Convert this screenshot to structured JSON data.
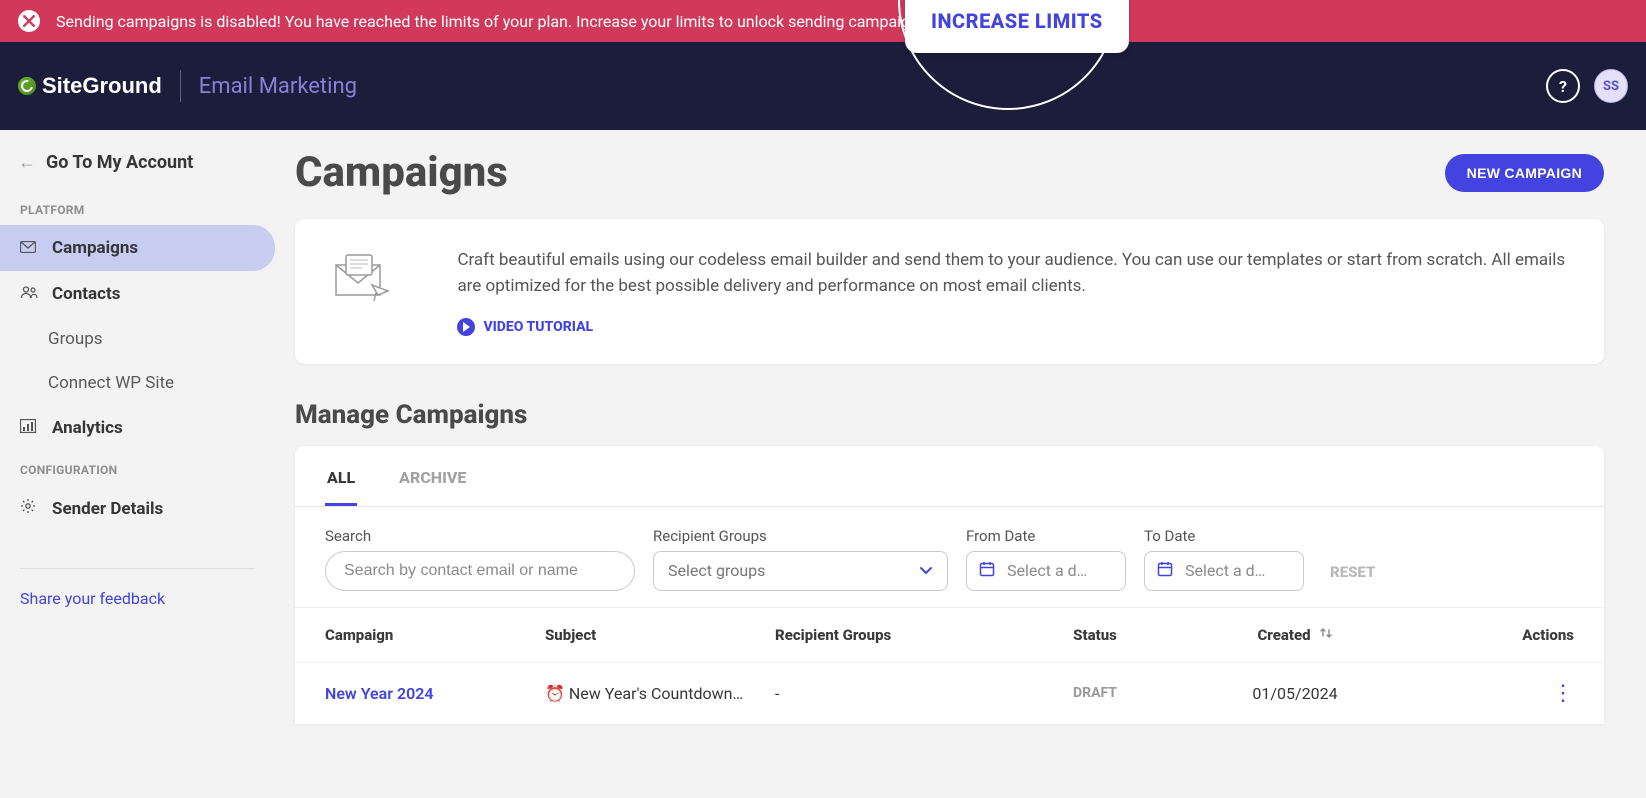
{
  "banner": {
    "message": "Sending campaigns is disabled! You have reached the limits of your plan. Increase your limits to unlock sending campaigns.",
    "increase_label": "INCREASE LIMITS"
  },
  "header": {
    "brand": "SiteGround",
    "product": "Email Marketing",
    "help": "?",
    "avatar_initials": "SS"
  },
  "sidebar": {
    "back_label": "Go To My Account",
    "platform_label": "PLATFORM",
    "configuration_label": "CONFIGURATION",
    "items": {
      "campaigns": "Campaigns",
      "contacts": "Contacts",
      "groups": "Groups",
      "connect_wp": "Connect WP Site",
      "analytics": "Analytics",
      "sender_details": "Sender Details"
    },
    "feedback_link": "Share your feedback"
  },
  "page": {
    "title": "Campaigns",
    "new_button": "NEW CAMPAIGN"
  },
  "intro": {
    "text": "Craft beautiful emails using our codeless email builder and send them to your audience. You can use our templates or start from scratch. All emails are optimized for the best possible delivery and performance on most email clients.",
    "tutorial": "VIDEO TUTORIAL"
  },
  "manage": {
    "title": "Manage Campaigns",
    "tabs": {
      "all": "ALL",
      "archive": "ARCHIVE"
    },
    "filters": {
      "search_label": "Search",
      "search_placeholder": "Search by contact email or name",
      "groups_label": "Recipient Groups",
      "groups_placeholder": "Select groups",
      "from_label": "From Date",
      "to_label": "To Date",
      "date_placeholder": "Select a d…",
      "reset": "RESET"
    },
    "columns": {
      "campaign": "Campaign",
      "subject": "Subject",
      "groups": "Recipient Groups",
      "status": "Status",
      "created": "Created",
      "actions": "Actions"
    },
    "rows": [
      {
        "campaign": "New Year 2024",
        "subject": "⏰ New Year's Countdown…",
        "groups": "-",
        "status": "DRAFT",
        "created": "01/05/2024"
      }
    ]
  }
}
